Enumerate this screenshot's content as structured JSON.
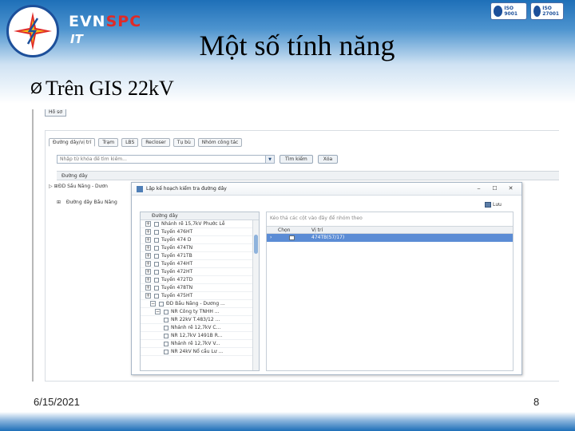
{
  "slide": {
    "title": "Một số tính năng",
    "bullet_marker": "Ø",
    "bullet": "Trên GIS 22kV",
    "date": "6/15/2021",
    "page_number": "8"
  },
  "logo": {
    "brand_evn": "EVN",
    "brand_spc": "SPC",
    "brand_it": "IT",
    "iso_badges": [
      "ISO 9001",
      "ISO 27001"
    ]
  },
  "app": {
    "top_tab": "Hồ sơ",
    "subtabs": [
      "Đường dây/vị trí",
      "Trạm",
      "LBS",
      "Recloser",
      "Tụ bù",
      "Nhóm công tác"
    ],
    "search_placeholder": "Nhập từ khóa để tìm kiếm...",
    "search_button": "Tìm kiếm",
    "clear_button": "Xóa",
    "grid_header": "Đường dây",
    "rows": [
      {
        "expander": "▷ ⊞",
        "label": "ĐD Sầu Năng - Dươn"
      },
      {
        "expander": "⊞",
        "label": "Đường dây Bầu Năng"
      }
    ]
  },
  "dialog": {
    "title": "Lập kế hoạch kiểm tra đường dây",
    "save_label": "Lưu",
    "tree_header": "Đường dây",
    "tree_items": [
      {
        "label": "Nhánh rẽ 15,7kV Phước Lễ",
        "level": 0,
        "expander": "+"
      },
      {
        "label": "Tuyến 476HT",
        "level": 0,
        "expander": "+"
      },
      {
        "label": "Tuyến 474 D",
        "level": 0,
        "expander": "+"
      },
      {
        "label": "Tuyến 474TN",
        "level": 0,
        "expander": "+"
      },
      {
        "label": "Tuyến 471TB",
        "level": 0,
        "expander": "+"
      },
      {
        "label": "Tuyến 474HT",
        "level": 0,
        "expander": "+"
      },
      {
        "label": "Tuyến 472HT",
        "level": 0,
        "expander": "+"
      },
      {
        "label": "Tuyến 472TD",
        "level": 0,
        "expander": "+"
      },
      {
        "label": "Tuyến 478TN",
        "level": 0,
        "expander": "+"
      },
      {
        "label": "Tuyến 475HT",
        "level": 0,
        "expander": "+"
      },
      {
        "label": "ĐD Bầu Năng - Dương ...",
        "level": 1,
        "expander": "−"
      },
      {
        "label": "NR Công ty TNHH ...",
        "level": 2,
        "expander": "−"
      },
      {
        "label": "NR 22kV T.483/12 ...",
        "level": 2,
        "expander": ""
      },
      {
        "label": "Nhánh rẽ 12,7kV C...",
        "level": 2,
        "expander": ""
      },
      {
        "label": "NR 12,7kV 1491B R...",
        "level": 2,
        "expander": ""
      },
      {
        "label": "Nhánh rẽ 12,7kV V...",
        "level": 2,
        "expander": ""
      },
      {
        "label": "NR 24kV Nổ cầu Lư ...",
        "level": 2,
        "expander": ""
      }
    ],
    "drop_hint": "Kéo thả các cột vào đây để nhóm theo",
    "col_choose": "Chọn",
    "col_position": "Vị trí",
    "selected_row": "474TB(57/17)"
  }
}
